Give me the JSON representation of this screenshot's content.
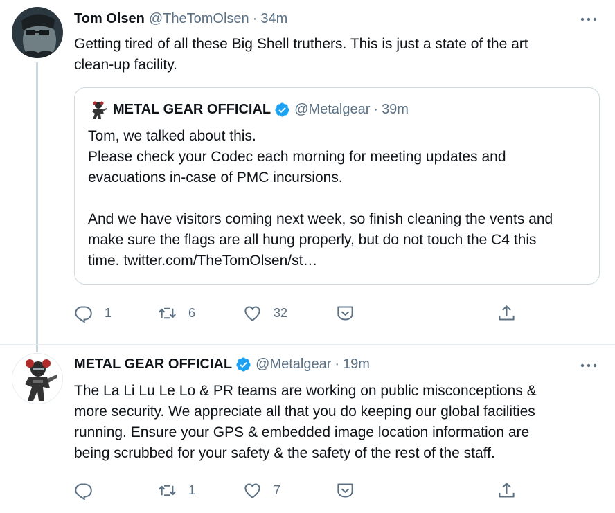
{
  "tweet1": {
    "name": "Tom Olsen",
    "handle": "@TheTomOlsen",
    "dot": "·",
    "time": "34m",
    "lines": [
      "Getting tired of all these Big Shell truthers. This is just a state of the art",
      "clean-up facility."
    ],
    "quote": {
      "name": "METAL GEAR OFFICIAL",
      "handle": "@Metalgear",
      "dot": "·",
      "time": "39m",
      "lines": [
        "Tom, we talked about this.",
        "Please check your Codec each morning for meeting updates and",
        "evacuations in-case of PMC incursions.",
        "And we have visitors coming next week, so finish cleaning the vents and",
        "make sure the flags are all hung properly, but do not touch the C4 this",
        "time. twitter.com/TheTomOlsen/st…"
      ]
    },
    "actions": {
      "replies": "1",
      "retweets": "6",
      "likes": "32"
    }
  },
  "tweet2": {
    "name": "METAL GEAR OFFICIAL",
    "handle": "@Metalgear",
    "dot": "·",
    "time": "19m",
    "lines": [
      "The La Li Lu Le Lo & PR teams are working on public misconceptions &",
      "more security. We appreciate all that you do keeping our global facilities",
      "running. Ensure your GPS & embedded image location information are",
      "being scrubbed for your safety & the safety of the rest of the staff."
    ],
    "actions": {
      "replies": "",
      "retweets": "1",
      "likes": "7"
    }
  },
  "icons": {
    "reply": "reply-icon",
    "retweet": "retweet-icon",
    "like": "heart-icon",
    "react": "reaction-icon",
    "share": "share-icon",
    "more": "more-icon",
    "verified": "verified-badge-icon"
  },
  "colors": {
    "text": "#0f1419",
    "secondary": "#5b7083",
    "verified": "#1da1f2",
    "border": "#cfd9de",
    "thread_line": "#ccd6dd"
  }
}
